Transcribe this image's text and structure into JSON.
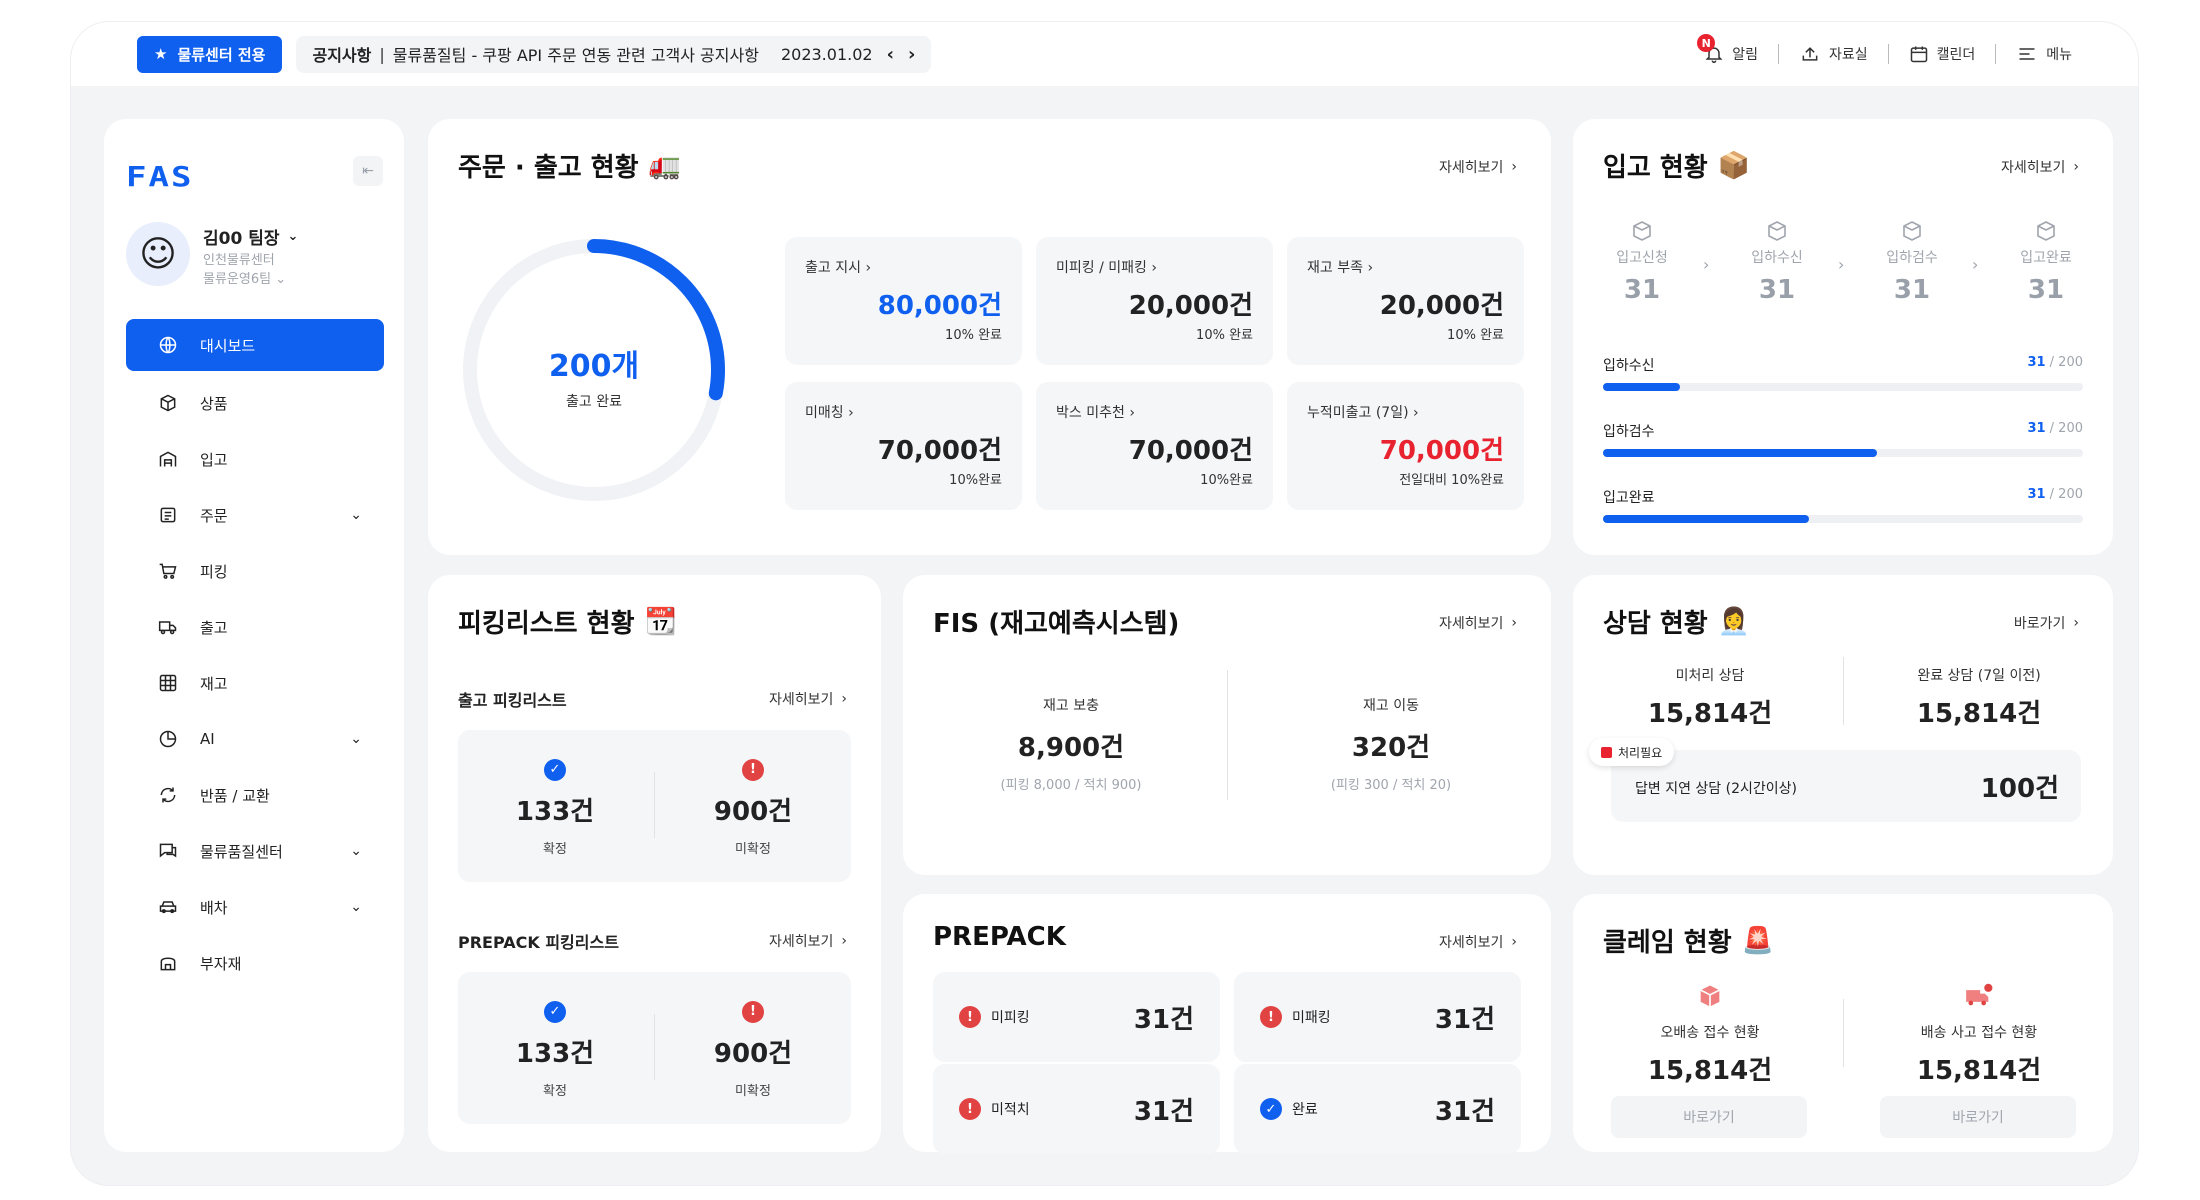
{
  "topbar": {
    "badge_label": "물류센터 전용",
    "notice_label": "공지사항",
    "notice_text": "물류품질팀 - 쿠팡 API 주문 연동 관련 고객사 공지사항",
    "notice_date": "2023.01.02",
    "menu": [
      {
        "label": "알림",
        "icon": "bell-icon",
        "badge": "N"
      },
      {
        "label": "자료실",
        "icon": "upload-icon"
      },
      {
        "label": "캘린더",
        "icon": "calendar-icon"
      },
      {
        "label": "메뉴",
        "icon": "hamburger-icon"
      }
    ]
  },
  "sidebar": {
    "logo": "FAS",
    "user_name": "김00 팀장",
    "user_center": "인천물류센터",
    "user_team": "물류운영6팀",
    "items": [
      {
        "label": "대시보드",
        "icon": "globe-icon",
        "active": true
      },
      {
        "label": "상품",
        "icon": "box-icon"
      },
      {
        "label": "입고",
        "icon": "warehouse-icon"
      },
      {
        "label": "주문",
        "icon": "order-list-icon",
        "expandable": true
      },
      {
        "label": "피킹",
        "icon": "cart-icon"
      },
      {
        "label": "출고",
        "icon": "truck-icon"
      },
      {
        "label": "재고",
        "icon": "grid-icon"
      },
      {
        "label": "AI",
        "icon": "pie-chart-icon",
        "expandable": true
      },
      {
        "label": "반품 / 교환",
        "icon": "refresh-icon"
      },
      {
        "label": "물류품질센터",
        "icon": "chat-icon",
        "expandable": true
      },
      {
        "label": "배차",
        "icon": "car-icon",
        "expandable": true
      },
      {
        "label": "부자재",
        "icon": "store-icon"
      }
    ]
  },
  "orders": {
    "title": "주문 · 출고 현황",
    "emoji": "🚛",
    "more": "자세히보기",
    "donut_value": "200개",
    "donut_label": "출고 완료",
    "donut_fraction": 0.28,
    "tiles": [
      {
        "label": "출고 지시",
        "value": "80,000건",
        "sub": "10% 완료",
        "color": "blue"
      },
      {
        "label": "미피킹 / 미패킹",
        "value": "20,000건",
        "sub": "10% 완료",
        "color": ""
      },
      {
        "label": "재고 부족",
        "value": "20,000건",
        "sub": "10% 완료",
        "color": ""
      },
      {
        "label": "미매칭",
        "value": "70,000건",
        "sub": "10%완료",
        "color": ""
      },
      {
        "label": "박스 미추천",
        "value": "70,000건",
        "sub": "10%완료",
        "color": ""
      },
      {
        "label": "누적미출고 (7일)",
        "value": "70,000건",
        "sub": "전일대비 10%완료",
        "color": "red"
      }
    ]
  },
  "inbound": {
    "title": "입고 현황",
    "emoji": "📦",
    "more": "자세히보기",
    "steps": [
      {
        "label": "입고신청",
        "value": "31"
      },
      {
        "label": "입하수신",
        "value": "31"
      },
      {
        "label": "입하검수",
        "value": "31"
      },
      {
        "label": "입고완료",
        "value": "31"
      }
    ],
    "bars": [
      {
        "label": "입하수신",
        "count": "31",
        "total": "/ 200",
        "fraction": 0.16
      },
      {
        "label": "입하검수",
        "count": "31",
        "total": "/ 200",
        "fraction": 0.57
      },
      {
        "label": "입고완료",
        "count": "31",
        "total": "/ 200",
        "fraction": 0.43
      }
    ]
  },
  "picking": {
    "title": "피킹리스트 현황",
    "emoji": "📆",
    "sections": [
      {
        "title": "출고 피킹리스트",
        "more": "자세히보기",
        "confirmed_value": "133건",
        "confirmed_label": "확정",
        "unconfirmed_value": "900건",
        "unconfirmed_label": "미확정"
      },
      {
        "title": "PREPACK 피킹리스트",
        "more": "자세히보기",
        "confirmed_value": "133건",
        "confirmed_label": "확정",
        "unconfirmed_value": "900건",
        "unconfirmed_label": "미확정"
      }
    ]
  },
  "fis": {
    "title": "FIS (재고예측시스템)",
    "more": "자세히보기",
    "cols": [
      {
        "label": "재고 보충",
        "value": "8,900건",
        "sub": "(피킹 8,000 / 적치 900)"
      },
      {
        "label": "재고 이동",
        "value": "320건",
        "sub": "(피킹 300 / 적치 20)"
      }
    ]
  },
  "prepack": {
    "title": "PREPACK",
    "more": "자세히보기",
    "items": [
      {
        "label": "미피킹",
        "value": "31건",
        "status": "warn"
      },
      {
        "label": "미패킹",
        "value": "31건",
        "status": "warn"
      },
      {
        "label": "미적치",
        "value": "31건",
        "status": "warn"
      },
      {
        "label": "완료",
        "value": "31건",
        "status": "done"
      }
    ]
  },
  "consult": {
    "title": "상담 현황",
    "emoji": "👩‍💼",
    "more": "바로가기",
    "cols": [
      {
        "label": "미처리 상담",
        "value": "15,814건"
      },
      {
        "label": "완료 상담 (7일 이전)",
        "value": "15,814건"
      }
    ],
    "tag": "처리필요",
    "delay_label": "답변 지연 상담 (2시간이상)",
    "delay_value": "100건"
  },
  "claim": {
    "title": "클레임 현황",
    "emoji": "🚨",
    "cols": [
      {
        "label": "오배송 접수 현황",
        "value": "15,814건",
        "button": "바로가기",
        "icon": "box-error-icon"
      },
      {
        "label": "배송 사고 접수 현황",
        "value": "15,814건",
        "button": "바로가기",
        "icon": "truck-error-icon"
      }
    ]
  }
}
